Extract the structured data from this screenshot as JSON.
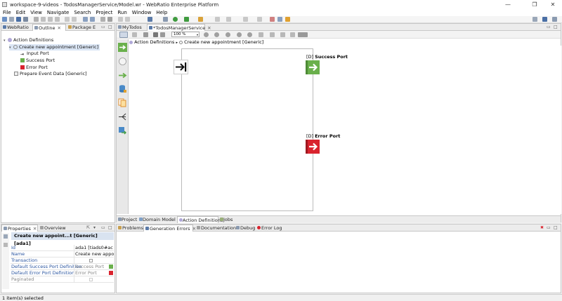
{
  "window": {
    "title": "workspace-9-videos - TodosManagerService/Model.wr - WebRatio Enterprise Platform",
    "minimize": "—",
    "maximize": "❐",
    "close": "✕"
  },
  "menu": [
    "File",
    "Edit",
    "View",
    "Navigate",
    "Search",
    "Project",
    "Run",
    "Window",
    "Help"
  ],
  "left_panel": {
    "tabs": [
      "WebRatio",
      "Outline",
      "Package E"
    ],
    "tree": {
      "root": "Action Definitions",
      "appointment": "Create new appointment [Generic]",
      "input_port": "Input Port",
      "success_port": "Success Port",
      "error_port": "Error Port",
      "prepare": "Prepare Event Data [Generic]"
    }
  },
  "editor": {
    "tabs": [
      "MyTodos",
      "*TodosManagerService"
    ],
    "zoom": "100 %",
    "breadcrumb": {
      "root": "Action Definitions",
      "current": "Create new appointment [Generic]"
    },
    "success_port": {
      "tag": "[D]",
      "label": "Success Port"
    },
    "error_port": {
      "tag": "[D]",
      "label": "Error Port"
    },
    "bottom_tabs": [
      "Project",
      "Domain Model",
      "Action Definitions",
      "Jobs"
    ]
  },
  "properties": {
    "tabs": [
      "Properties",
      "Overview"
    ],
    "header": "Create new appoint...t [Generic] [ada1]",
    "rows": [
      {
        "key": "Id",
        "value": "ada1  [tiads0#ac"
      },
      {
        "key": "Name",
        "value": "Create new appoi"
      },
      {
        "key": "Transaction",
        "value": ""
      },
      {
        "key": "Default Success Port Definition",
        "value": "Success Port"
      },
      {
        "key": "Default Error Port Definition",
        "value": "Error Port"
      },
      {
        "key": "Paginated",
        "value": ""
      }
    ]
  },
  "bottom_panel": {
    "tabs": [
      "Problems",
      "Generation Errors",
      "Documentation",
      "Debug",
      "Error Log"
    ]
  },
  "status": "1 item(s) selected",
  "colors": {
    "success": "#6ab04c",
    "error": "#d9232e"
  }
}
